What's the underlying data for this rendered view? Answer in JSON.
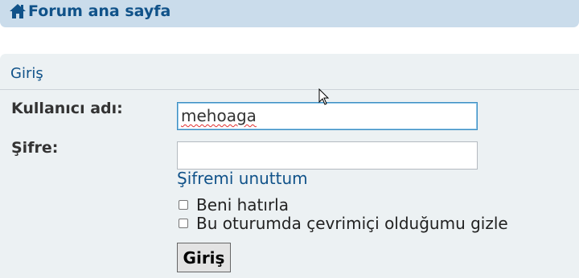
{
  "header": {
    "home_icon": "home-icon",
    "home_link_label": "Forum ana sayfa"
  },
  "login_panel": {
    "title": "Giriş",
    "username_label": "Kullanıcı adı:",
    "username_value": "mehoaga",
    "password_label": "Şifre:",
    "password_value": "",
    "forgot_password_link": "Şifremi unuttum",
    "remember_me_label": "Beni hatırla",
    "remember_me_checked": false,
    "hide_online_label": "Bu oturumda çevrimiçi olduğumu gizle",
    "hide_online_checked": false,
    "submit_label": "Giriş"
  },
  "colors": {
    "link": "#105289",
    "header_bg": "#cadceb",
    "panel_bg": "#ecf1f3",
    "label_text": "#333333"
  }
}
